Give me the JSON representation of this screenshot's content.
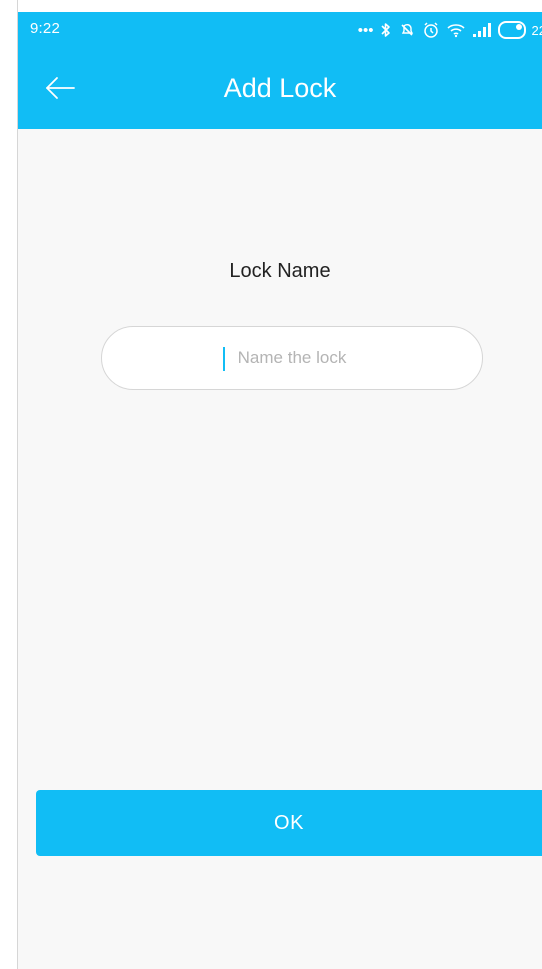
{
  "status_bar": {
    "time": "9:22",
    "battery_text": "22",
    "icons": [
      "more-dots-icon",
      "bluetooth-icon",
      "no-alarm-icon",
      "alarm-icon",
      "wifi-icon",
      "signal-icon",
      "battery-icon"
    ]
  },
  "header": {
    "title": "Add Lock",
    "back_icon": "arrow-left-icon"
  },
  "form": {
    "label": "Lock Name",
    "input": {
      "value": "",
      "placeholder": "Name the lock"
    }
  },
  "actions": {
    "ok_label": "OK"
  },
  "colors": {
    "accent": "#11bdf5",
    "background": "#f8f8f8",
    "text": "#222222",
    "placeholder": "#b4b4b4"
  }
}
